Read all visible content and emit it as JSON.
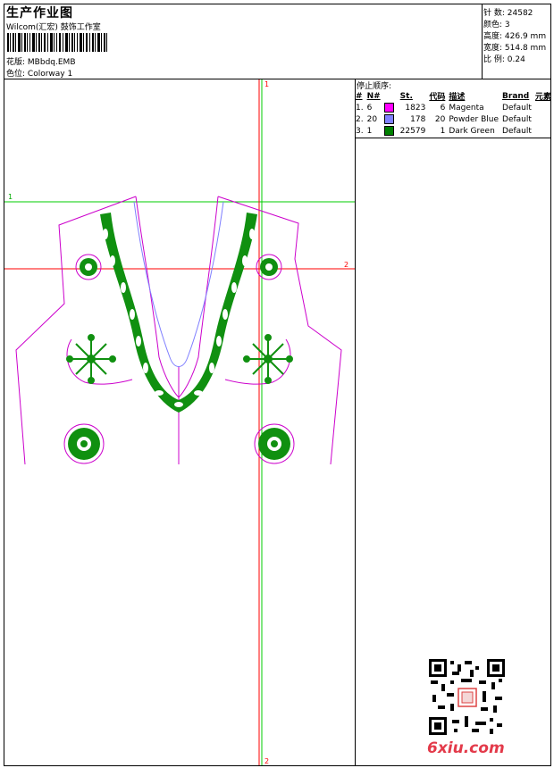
{
  "header": {
    "title": "生产作业图",
    "subtitle": "Wilcom(汇宏) 鼓饰工作室",
    "design_label": "花版:",
    "design_value": "MBbdq.EMB",
    "colorway_label": "色位:",
    "colorway_value": "Colorway 1"
  },
  "stats": [
    {
      "label": "针 数:",
      "value": "24582"
    },
    {
      "label": "颜色:",
      "value": "3"
    },
    {
      "label": "高度:",
      "value": "426.9 mm"
    },
    {
      "label": "宽度:",
      "value": "514.8 mm"
    },
    {
      "label": "比 例:",
      "value": "0.24"
    }
  ],
  "stop_sequence": {
    "title": "停止顺序:",
    "headers": [
      "#",
      "N#",
      "",
      "St.",
      "代码",
      "描述",
      "Brand",
      "元素"
    ],
    "rows": [
      {
        "index": "1.",
        "n": "6",
        "color": "#ff00ff",
        "stitches": "1823",
        "code": "6",
        "desc": "Magenta",
        "brand": "Default"
      },
      {
        "index": "2.",
        "n": "20",
        "color": "#8080ff",
        "stitches": "178",
        "code": "20",
        "desc": "Powder Blue",
        "brand": "Default"
      },
      {
        "index": "3.",
        "n": "1",
        "color": "#008000",
        "stitches": "22579",
        "code": "1",
        "desc": "Dark Green",
        "brand": "Default"
      }
    ]
  },
  "canvas": {
    "guide_labels": {
      "h_green": "1",
      "h_red": "2",
      "v_red_top": "1",
      "v_red_bottom": "2"
    }
  },
  "watermark": "6xiu.com",
  "colors": {
    "magenta": "#cc00cc",
    "blue": "#7f7fff",
    "green": "#109010",
    "guide_green": "#00cc00",
    "guide_red": "#ff0000"
  }
}
